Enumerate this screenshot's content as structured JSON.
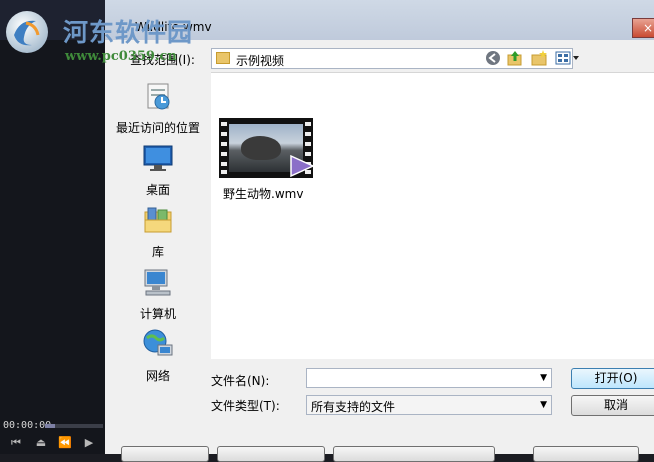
{
  "watermark": {
    "title": "河东软件园",
    "url": "www.pc0359.cn"
  },
  "player": {
    "timecode": "00:00:00",
    "progress": 0.17
  },
  "dialog": {
    "title": "Wildlife.wmv",
    "close_icon": "×",
    "lookin_label": "查找范围(I):",
    "lookin_value": "示例视频",
    "toolbar_icons": [
      "back-icon",
      "up-folder-icon",
      "new-folder-icon",
      "view-menu-icon"
    ],
    "places": [
      {
        "label": "最近访问的位置",
        "icon": "recent-places-icon"
      },
      {
        "label": "桌面",
        "icon": "desktop-icon"
      },
      {
        "label": "库",
        "icon": "libraries-icon"
      },
      {
        "label": "计算机",
        "icon": "computer-icon"
      },
      {
        "label": "网络",
        "icon": "network-icon"
      }
    ],
    "files": [
      {
        "name": "野生动物.wmv",
        "icon": "video-file-icon"
      }
    ],
    "filename_label": "文件名(N):",
    "filename_value": "",
    "filetype_label": "文件类型(T):",
    "filetype_value": "所有支持的文件",
    "open_button": "打开(O)",
    "cancel_button": "取消"
  },
  "colors": {
    "accent": "#3c7fb1",
    "titlebar": "#c7d2e1",
    "close": "#c94b33"
  }
}
